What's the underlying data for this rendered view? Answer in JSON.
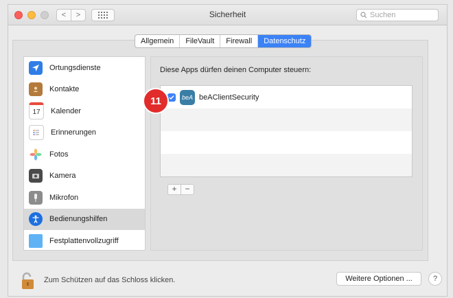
{
  "window": {
    "title": "Sicherheit",
    "search": {
      "placeholder": "Suchen"
    },
    "nav": {
      "back": "<",
      "forward": ">"
    }
  },
  "tabs": [
    {
      "label": "Allgemein",
      "active": false
    },
    {
      "label": "FileVault",
      "active": false
    },
    {
      "label": "Firewall",
      "active": false
    },
    {
      "label": "Datenschutz",
      "active": true
    }
  ],
  "sidebar": {
    "items": [
      {
        "label": "Ortungsdienste",
        "icon": "location-arrow-icon",
        "selected": false
      },
      {
        "label": "Kontakte",
        "icon": "contacts-book-icon",
        "selected": false
      },
      {
        "label": "Kalender",
        "icon": "calendar-icon",
        "selected": false,
        "icon_text": "17"
      },
      {
        "label": "Erinnerungen",
        "icon": "reminders-list-icon",
        "selected": false
      },
      {
        "label": "Fotos",
        "icon": "photos-flower-icon",
        "selected": false
      },
      {
        "label": "Kamera",
        "icon": "camera-icon",
        "selected": false
      },
      {
        "label": "Mikrofon",
        "icon": "microphone-icon",
        "selected": false
      },
      {
        "label": "Bedienungshilfen",
        "icon": "accessibility-icon",
        "selected": true
      },
      {
        "label": "Festplattenvollzugriff",
        "icon": "folder-icon",
        "selected": false
      }
    ]
  },
  "main": {
    "header": "Diese Apps dürfen deinen Computer steuern:",
    "apps": [
      {
        "name": "beAClientSecurity",
        "checked": true,
        "icon_text": "beA"
      }
    ],
    "badge": "11",
    "plus": "+",
    "minus": "−"
  },
  "footer": {
    "lock_text": "Zum Schützen auf das Schloss klicken.",
    "options_button": "Weitere Optionen ...",
    "help": "?"
  },
  "colors": {
    "accent": "#3b82f6",
    "badge": "#e22b2b",
    "close": "#fc605c",
    "minimize": "#fdbc40"
  }
}
